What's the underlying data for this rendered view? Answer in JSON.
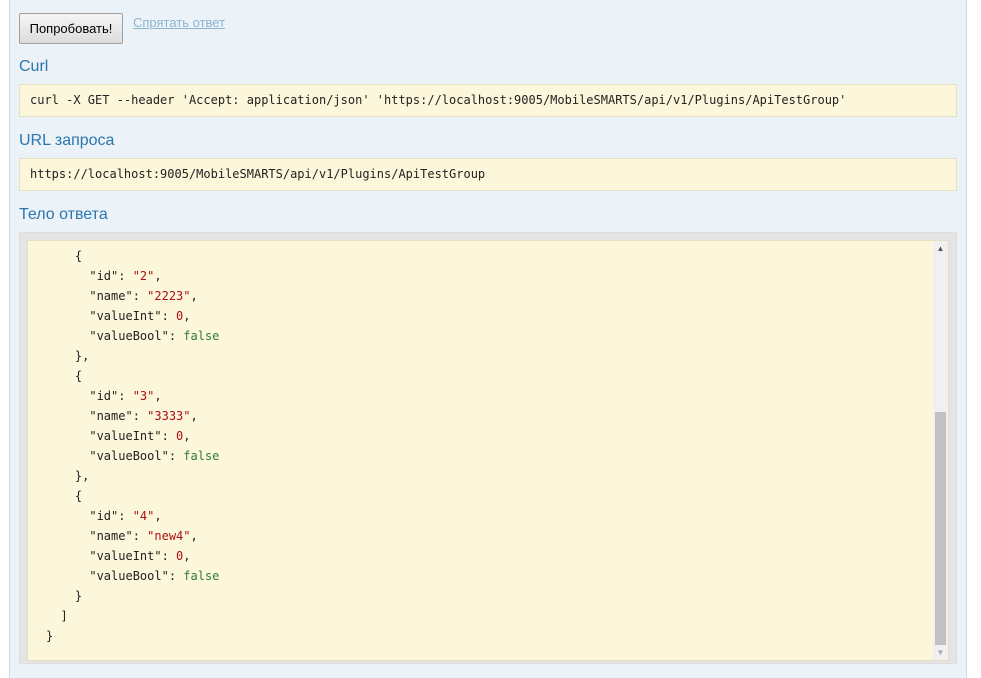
{
  "actions": {
    "try_label": "Попробовать!",
    "hide_label": "Спрятать ответ"
  },
  "curl": {
    "title": "Curl",
    "command": "curl -X GET --header 'Accept: application/json' 'https://localhost:9005/MobileSMARTS/api/v1/Plugins/ApiTestGroup'"
  },
  "request_url": {
    "title": "URL запроса",
    "value": "https://localhost:9005/MobileSMARTS/api/v1/Plugins/ApiTestGroup"
  },
  "response": {
    "title": "Тело ответа",
    "scroll_fraction": 0.62,
    "lines": [
      [
        {
          "t": "    {"
        }
      ],
      [
        {
          "t": "      \"id\": "
        },
        {
          "t": "\"2\"",
          "c": "str"
        },
        {
          "t": ","
        }
      ],
      [
        {
          "t": "      \"name\": "
        },
        {
          "t": "\"2223\"",
          "c": "str"
        },
        {
          "t": ","
        }
      ],
      [
        {
          "t": "      \"valueInt\": "
        },
        {
          "t": "0",
          "c": "num"
        },
        {
          "t": ","
        }
      ],
      [
        {
          "t": "      \"valueBool\": "
        },
        {
          "t": "false",
          "c": "bool"
        }
      ],
      [
        {
          "t": "    },"
        }
      ],
      [
        {
          "t": "    {"
        }
      ],
      [
        {
          "t": "      \"id\": "
        },
        {
          "t": "\"3\"",
          "c": "str"
        },
        {
          "t": ","
        }
      ],
      [
        {
          "t": "      \"name\": "
        },
        {
          "t": "\"3333\"",
          "c": "str"
        },
        {
          "t": ","
        }
      ],
      [
        {
          "t": "      \"valueInt\": "
        },
        {
          "t": "0",
          "c": "num"
        },
        {
          "t": ","
        }
      ],
      [
        {
          "t": "      \"valueBool\": "
        },
        {
          "t": "false",
          "c": "bool"
        }
      ],
      [
        {
          "t": "    },"
        }
      ],
      [
        {
          "t": "    {"
        }
      ],
      [
        {
          "t": "      \"id\": "
        },
        {
          "t": "\"4\"",
          "c": "str"
        },
        {
          "t": ","
        }
      ],
      [
        {
          "t": "      \"name\": "
        },
        {
          "t": "\"new4\"",
          "c": "str"
        },
        {
          "t": ","
        }
      ],
      [
        {
          "t": "      \"valueInt\": "
        },
        {
          "t": "0",
          "c": "num"
        },
        {
          "t": ","
        }
      ],
      [
        {
          "t": "      \"valueBool\": "
        },
        {
          "t": "false",
          "c": "bool"
        }
      ],
      [
        {
          "t": "    }"
        }
      ],
      [
        {
          "t": "  ]"
        }
      ],
      [
        {
          "t": "}"
        }
      ]
    ]
  },
  "colors": {
    "title": "#2a76ad",
    "link": "#8bb4cf",
    "code_bg": "#fcf6db",
    "string": "#a11",
    "boolean": "#2e7d32"
  }
}
